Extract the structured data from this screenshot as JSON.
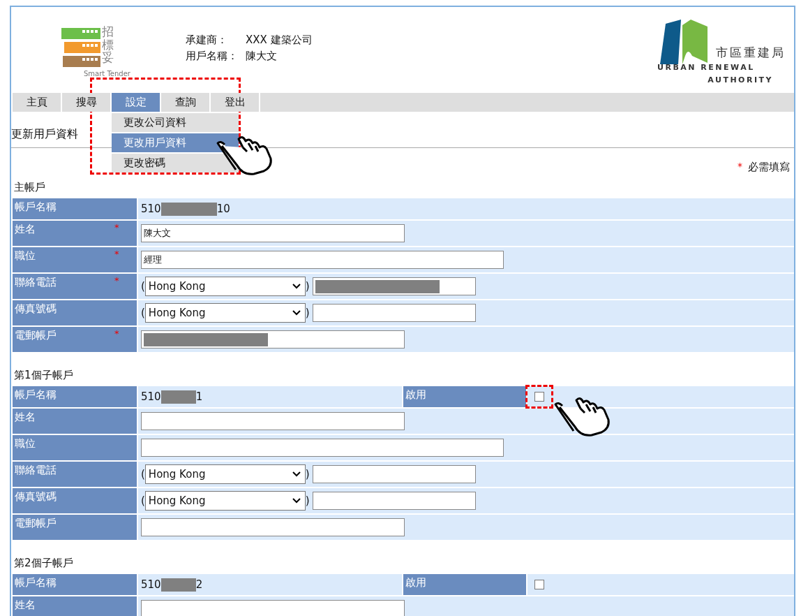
{
  "header": {
    "logo": {
      "chars": [
        "招",
        "標",
        "妥"
      ],
      "subtitle": "Smart Tender"
    },
    "info": [
      {
        "label": "承建商：",
        "value": "XXX 建築公司"
      },
      {
        "label": "用戶名稱：",
        "value": "陳大文"
      }
    ],
    "org_logo": {
      "chinese": "市區重建局",
      "english_lines": [
        "URBAN RENEWAL",
        "AUTHORITY"
      ]
    }
  },
  "nav": {
    "tabs": [
      {
        "label": "主頁",
        "selected": false
      },
      {
        "label": "搜尋",
        "selected": false
      },
      {
        "label": "設定",
        "selected": true,
        "menu": [
          {
            "label": "更改公司資料",
            "selected": false
          },
          {
            "label": "更改用戶資料",
            "selected": true
          },
          {
            "label": "更改密碼",
            "selected": false
          }
        ],
        "highlighted": true
      },
      {
        "label": "查詢",
        "selected": false
      },
      {
        "label": "登出",
        "selected": false
      }
    ]
  },
  "page_title": "更新用戶資料",
  "required_note": {
    "mark": "*",
    "text": "必需填寫"
  },
  "sections": [
    {
      "title": "主帳戶",
      "rows": [
        {
          "kind": "account",
          "label": "帳戶名稱",
          "prefix": "510",
          "suffix": "10"
        },
        {
          "kind": "text",
          "label": "姓名",
          "required": true,
          "value": "陳大文",
          "wide": false
        },
        {
          "kind": "text",
          "label": "職位",
          "required": true,
          "value": "經理",
          "wide": true
        },
        {
          "kind": "phone",
          "label": "聯絡電話",
          "required": true,
          "brackets": [
            "(",
            ")"
          ],
          "country": "Hong Kong",
          "redacted": true
        },
        {
          "kind": "phone",
          "label": "傳真號碼",
          "required": false,
          "brackets": [
            "(",
            ")"
          ],
          "country": "Hong Kong",
          "redacted": false
        },
        {
          "kind": "text",
          "label": "電郵帳戶",
          "required": true,
          "redacted": true,
          "wide": false
        }
      ]
    },
    {
      "title": "第1個子帳戶",
      "rows": [
        {
          "kind": "account",
          "label": "帳戶名稱",
          "prefix": "510",
          "suffix": "1",
          "enable_label": "啟用",
          "enabled": false,
          "highlighted": true
        },
        {
          "kind": "text",
          "label": "姓名",
          "required": false,
          "wide": false
        },
        {
          "kind": "text",
          "label": "職位",
          "required": false,
          "wide": true
        },
        {
          "kind": "phone",
          "label": "聯絡電話",
          "required": false,
          "brackets": [
            "(",
            ")"
          ],
          "country": "Hong Kong",
          "redacted": false
        },
        {
          "kind": "phone",
          "label": "傳真號碼",
          "required": false,
          "brackets": [
            "(",
            ")"
          ],
          "country": "Hong Kong",
          "redacted": false
        },
        {
          "kind": "text",
          "label": "電郵帳戶",
          "required": false,
          "wide": false
        }
      ]
    },
    {
      "title": "第2個子帳戶",
      "rows": [
        {
          "kind": "account",
          "label": "帳戶名稱",
          "prefix": "510",
          "suffix": "2",
          "enable_label": "啟用",
          "enabled": false,
          "highlighted": false
        },
        {
          "kind": "text",
          "label": "姓名",
          "required": false,
          "wide": false
        }
      ]
    }
  ]
}
